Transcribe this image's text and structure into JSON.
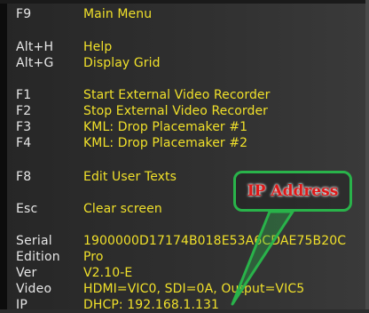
{
  "menu": [
    {
      "key": "F9",
      "label": "Main Menu"
    },
    {
      "key": "Alt+H",
      "label": "Help"
    },
    {
      "key": "Alt+G",
      "label": "Display Grid"
    },
    {
      "key": "F1",
      "label": "Start External Video Recorder"
    },
    {
      "key": "F2",
      "label": "Stop External Video Recorder"
    },
    {
      "key": "F3",
      "label": "KML: Drop Placemaker #1"
    },
    {
      "key": "F4",
      "label": "KML: Drop Placemaker #2"
    },
    {
      "key": "F8",
      "label": "Edit User Texts"
    },
    {
      "key": "Esc",
      "label": "Clear screen"
    }
  ],
  "info": [
    {
      "key": "Serial",
      "value": "1900000D17174B018E53A6CDAE75B20C"
    },
    {
      "key": "Edition",
      "value": "Pro"
    },
    {
      "key": "Ver",
      "value": "V2.10-E"
    },
    {
      "key": "Video",
      "value": "HDMI=VIC0, SDI=0A, Output=VIC5"
    },
    {
      "key": "IP",
      "value": "DHCP: 192.168.1.131"
    }
  ],
  "callout": {
    "text": "IP Address",
    "border_color": "#29b34a",
    "text_color": "#e01818"
  },
  "colors": {
    "key_text": "#e6e6e6",
    "value_text": "#f0e02a",
    "background": "#2c2c2c"
  }
}
